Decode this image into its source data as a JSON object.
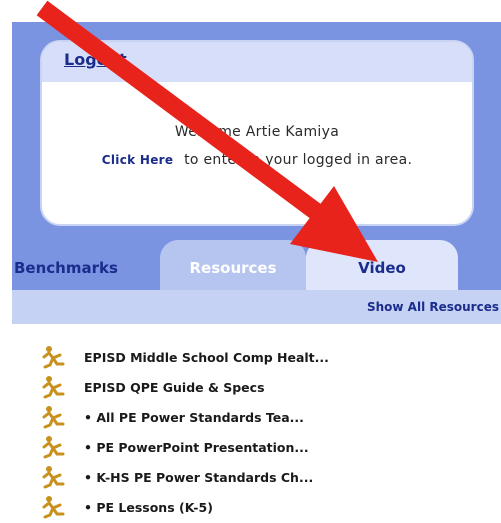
{
  "welcome": {
    "logout_label": "Logout",
    "greeting": "Welcome Artie Kamiya",
    "click_here_label": "Click Here",
    "enter_text": "to enter in your logged in area."
  },
  "tabs": [
    {
      "label": "Benchmarks"
    },
    {
      "label": "Resources"
    },
    {
      "label": "Video"
    }
  ],
  "show_all_label": "Show All Resources",
  "resources": [
    {
      "label": "EPISD Middle School Comp Healt..."
    },
    {
      "label": "EPISD QPE Guide & Specs"
    },
    {
      "label": "• All PE Power Standards Tea..."
    },
    {
      "label": "• PE PowerPoint Presentation..."
    },
    {
      "label": "• K-HS PE Power Standards Ch..."
    },
    {
      "label": "• PE Lessons (K-5)"
    }
  ],
  "icons": {
    "resource_icon": "runner-icon",
    "annotation": "red-arrow-icon"
  },
  "colors": {
    "panel_blue": "#7b94e2",
    "link_blue": "#1a2c8c",
    "arrow_red": "#e8231b",
    "icon_gold": "#c8901c"
  }
}
